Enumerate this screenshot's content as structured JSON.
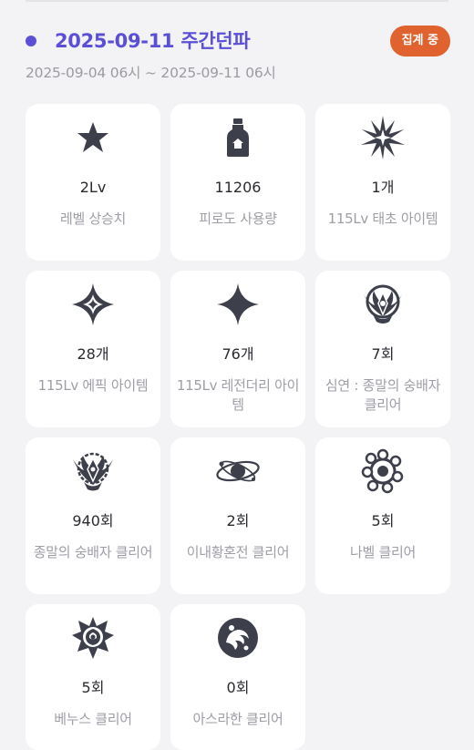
{
  "header": {
    "title": "2025-09-11 주간던파",
    "status_badge": "집계 중",
    "period": "2025-09-04 06시 ~ 2025-09-11 06시",
    "accent_color": "#5a4fd6",
    "badge_color": "#e0622f"
  },
  "cards": [
    {
      "icon": "star-icon",
      "value": "2Lv",
      "label": "레벨 상승치"
    },
    {
      "icon": "potion-bottle-icon",
      "value": "11206",
      "label": "피로도 사용량"
    },
    {
      "icon": "burst-star-icon",
      "value": "1개",
      "label": "115Lv 태초 아이템"
    },
    {
      "icon": "sparkle-star-icon",
      "value": "28개",
      "label": "115Lv 에픽 아이템"
    },
    {
      "icon": "four-point-star-icon",
      "value": "76개",
      "label": "115Lv 레전더리 아이템"
    },
    {
      "icon": "abyss-emblem-icon",
      "value": "7회",
      "label": "심연 : 종말의 숭배자 클리어"
    },
    {
      "icon": "end-worshipper-emblem-icon",
      "value": "940회",
      "label": "종말의 숭배자 클리어"
    },
    {
      "icon": "planet-orbit-icon",
      "value": "2회",
      "label": "이내황혼전 클리어"
    },
    {
      "icon": "nabel-emblem-icon",
      "value": "5회",
      "label": "나벨 클리어"
    },
    {
      "icon": "venus-emblem-icon",
      "value": "5회",
      "label": "베누스 클리어"
    },
    {
      "icon": "asrahan-emblem-icon",
      "value": "0회",
      "label": "아스라한 클리어"
    }
  ]
}
